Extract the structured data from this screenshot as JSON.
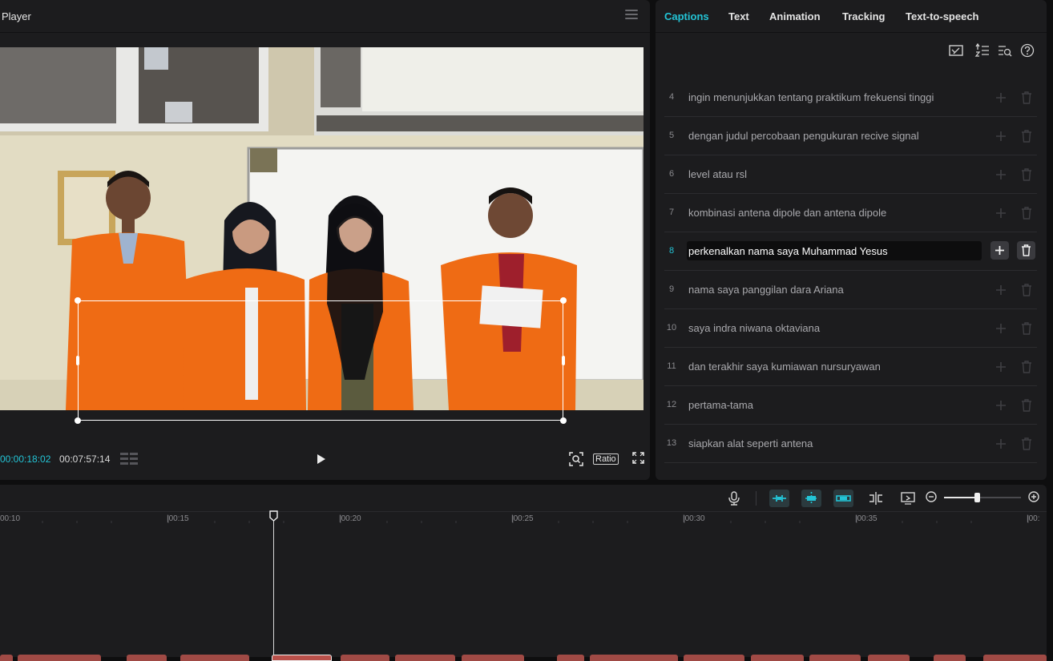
{
  "player": {
    "title": "Player",
    "current_time": "00:00:18:02",
    "total_time": "00:07:57:14",
    "ratio_label": "Ratio"
  },
  "right_panel": {
    "tabs": [
      "Captions",
      "Text",
      "Animation",
      "Tracking",
      "Text-to-speech"
    ],
    "active_tab": "Captions",
    "captions": [
      {
        "num": "4",
        "text": "ingin menunjukkan tentang praktikum frekuensi tinggi"
      },
      {
        "num": "5",
        "text": "dengan judul percobaan pengukuran recive signal"
      },
      {
        "num": "6",
        "text": "level atau rsl"
      },
      {
        "num": "7",
        "text": "kombinasi antena dipole dan antena dipole"
      },
      {
        "num": "8",
        "text": "perkenalkan nama saya Muhammad Yesus",
        "editing": true
      },
      {
        "num": "9",
        "text": "nama saya panggilan dara Ariana"
      },
      {
        "num": "10",
        "text": "saya indra niwana oktaviana"
      },
      {
        "num": "11",
        "text": "dan terakhir saya kumiawan nursuryawan"
      },
      {
        "num": "12",
        "text": "pertama-tama"
      },
      {
        "num": "13",
        "text": "siapkan alat seperti antena"
      }
    ]
  },
  "timeline": {
    "ticks": [
      "00:10",
      "|00:15",
      "|00:20",
      "|00:25",
      "|00:30",
      "|00:35",
      "|00:"
    ]
  },
  "colors": {
    "accent": "#23c4d6",
    "panel_bg": "#1c1c1e",
    "app_bg": "#0e0e0f",
    "clip": "#a04a45"
  }
}
